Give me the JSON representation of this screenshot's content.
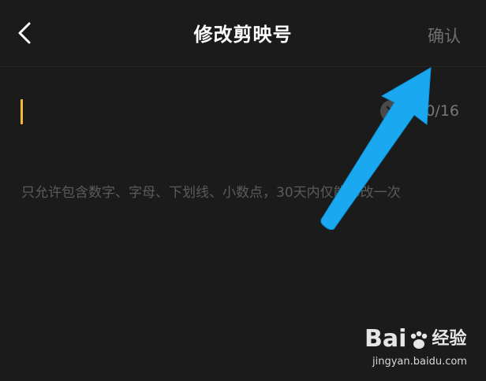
{
  "header": {
    "title": "修改剪映号",
    "back_icon": "chevron-left-icon",
    "confirm_label": "确认"
  },
  "input": {
    "value": "",
    "char_count": "0/16",
    "clear_icon": "clear-icon"
  },
  "hint": "只允许包含数字、字母、下划线、小数点，30天内仅能修改一次",
  "watermark": {
    "logo_prefix": "Bai",
    "logo_suffix": "经验",
    "url": "jingyan.baidu.com"
  },
  "colors": {
    "background": "#1b1b1b",
    "caret": "#f5b938",
    "annotation_arrow": "#1aa9f0",
    "confirm_disabled": "#6f6f6f",
    "hint_text": "#5b5b5b"
  }
}
